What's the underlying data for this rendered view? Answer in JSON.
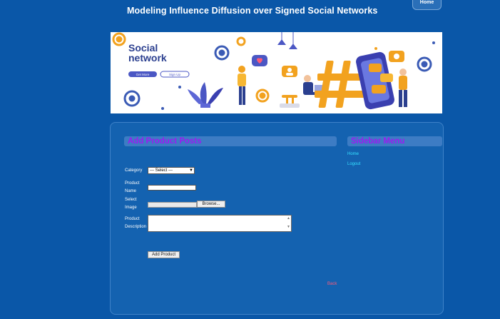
{
  "header": {
    "title": "Modeling Influence Diffusion over Signed Social Networks",
    "home_tab": "Home"
  },
  "banner": {
    "heading_line1": "Social",
    "heading_line2": "network",
    "button_primary": "Get More",
    "button_secondary": "Sign Up"
  },
  "main": {
    "heading": "Add Product Posts",
    "form": {
      "category_label": "Category",
      "category_selected": "--- Select ---",
      "product_name_label_line1": "Product",
      "product_name_label_line2": "Name",
      "image_label_line1": "Select",
      "image_label_line2": "Image",
      "browse_button": "Browse...",
      "description_label_line1": "Product",
      "description_label_line2": "Description",
      "submit_button": "Add Product"
    },
    "back_link": "Back"
  },
  "sidebar": {
    "heading": "Sidebar Menu",
    "items": [
      {
        "label": "Home"
      },
      {
        "label": "Logout"
      }
    ]
  },
  "colors": {
    "page_bg": "#0a57a8",
    "panel_bg": "#1462b0",
    "heading_bar": "#3d7cc4",
    "heading_text": "#9b1cf0",
    "link": "#35e0ff",
    "back_link": "#ff5a78"
  }
}
